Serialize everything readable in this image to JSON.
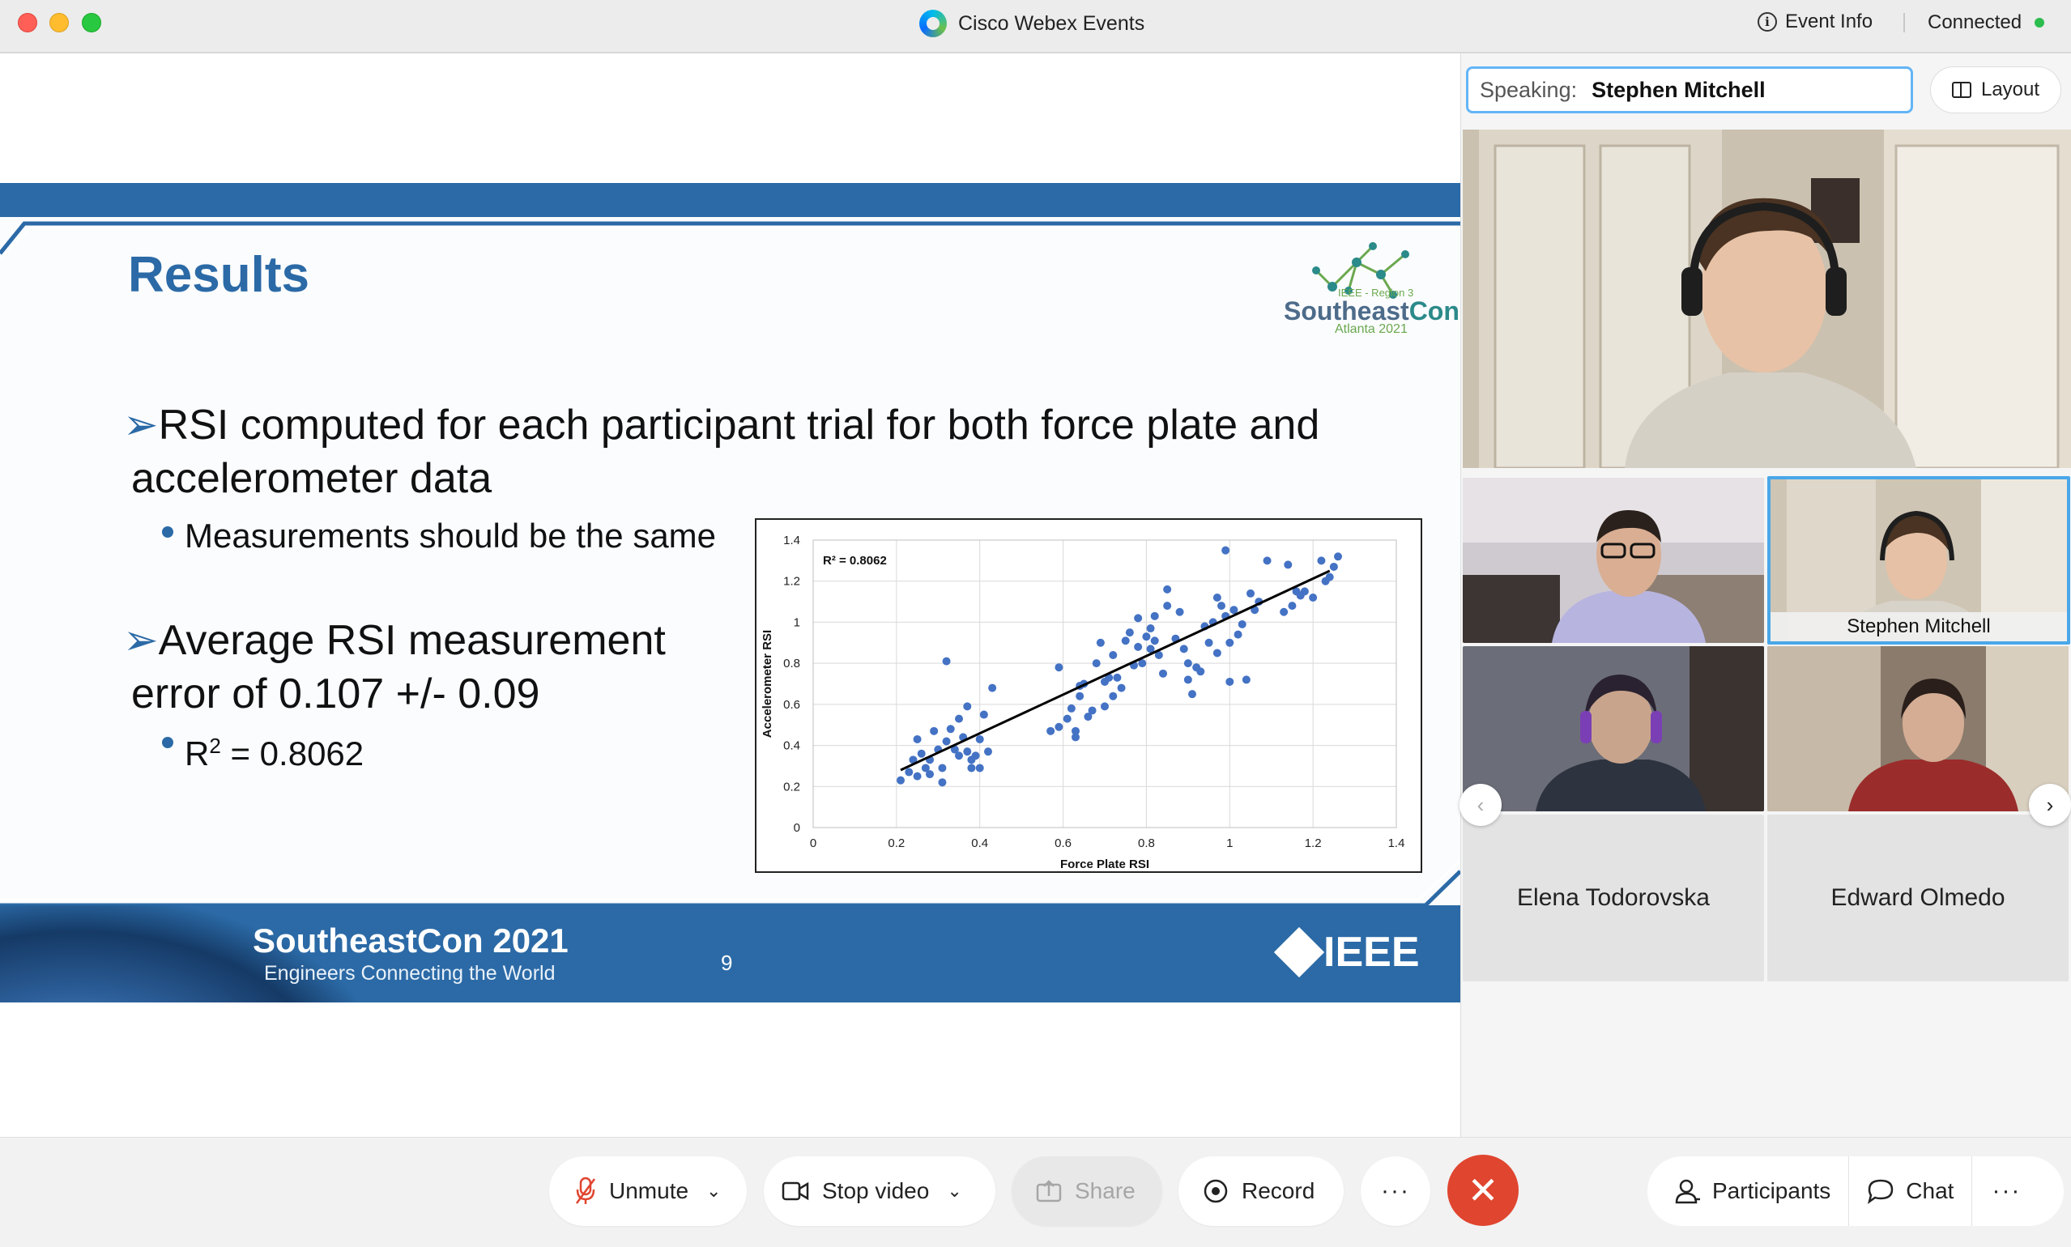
{
  "window": {
    "title": "Cisco Webex Events",
    "event_info": "Event Info",
    "status": "Connected"
  },
  "slide": {
    "title": "Results",
    "logo": {
      "line1": "IEEE - Region 3",
      "word_a": "Southeast",
      "word_b": "Con",
      "sub": "Atlanta 2021"
    },
    "bullets": [
      {
        "text": "RSI computed for each participant trial for both force plate and accelerometer data",
        "sub": "Measurements should be the same"
      },
      {
        "text": "Average RSI measurement error of 0.107 +/- 0.09",
        "sub_prefix": "R",
        "sub_sup": "2",
        "sub_suffix": " = 0.8062"
      }
    ],
    "footer": {
      "title": "SoutheastCon 2021",
      "subtitle": "Engineers Connecting the World",
      "page": "9",
      "org": "IEEE"
    }
  },
  "chart_data": {
    "type": "scatter",
    "xlabel": "Force Plate RSI",
    "ylabel": "Accelerometer RSI",
    "annotation": "R² = 0.8062",
    "xlim": [
      0,
      1.4
    ],
    "ylim": [
      0,
      1.4
    ],
    "xticks": [
      "0",
      "0.2",
      "0.4",
      "0.6",
      "0.8",
      "1",
      "1.2",
      "1.4"
    ],
    "yticks": [
      "0",
      "0.2",
      "0.4",
      "0.6",
      "0.8",
      "1",
      "1.2",
      "1.4"
    ],
    "grid": true,
    "point_color": "#4472c4",
    "trendline": {
      "x1": 0.21,
      "y1": 0.28,
      "x2": 1.24,
      "y2": 1.25
    },
    "points": [
      [
        0.21,
        0.23
      ],
      [
        0.23,
        0.27
      ],
      [
        0.24,
        0.33
      ],
      [
        0.25,
        0.25
      ],
      [
        0.25,
        0.43
      ],
      [
        0.26,
        0.36
      ],
      [
        0.27,
        0.29
      ],
      [
        0.28,
        0.33
      ],
      [
        0.28,
        0.26
      ],
      [
        0.29,
        0.47
      ],
      [
        0.3,
        0.38
      ],
      [
        0.31,
        0.22
      ],
      [
        0.31,
        0.29
      ],
      [
        0.32,
        0.42
      ],
      [
        0.32,
        0.81
      ],
      [
        0.33,
        0.48
      ],
      [
        0.34,
        0.38
      ],
      [
        0.35,
        0.35
      ],
      [
        0.35,
        0.53
      ],
      [
        0.36,
        0.44
      ],
      [
        0.37,
        0.37
      ],
      [
        0.37,
        0.59
      ],
      [
        0.38,
        0.33
      ],
      [
        0.38,
        0.29
      ],
      [
        0.39,
        0.35
      ],
      [
        0.4,
        0.29
      ],
      [
        0.4,
        0.43
      ],
      [
        0.41,
        0.55
      ],
      [
        0.42,
        0.37
      ],
      [
        0.43,
        0.68
      ],
      [
        0.57,
        0.47
      ],
      [
        0.59,
        0.49
      ],
      [
        0.59,
        0.78
      ],
      [
        0.61,
        0.53
      ],
      [
        0.62,
        0.58
      ],
      [
        0.63,
        0.44
      ],
      [
        0.63,
        0.47
      ],
      [
        0.64,
        0.64
      ],
      [
        0.64,
        0.69
      ],
      [
        0.65,
        0.7
      ],
      [
        0.66,
        0.54
      ],
      [
        0.67,
        0.57
      ],
      [
        0.68,
        0.8
      ],
      [
        0.69,
        0.9
      ],
      [
        0.7,
        0.71
      ],
      [
        0.7,
        0.59
      ],
      [
        0.71,
        0.73
      ],
      [
        0.72,
        0.84
      ],
      [
        0.72,
        0.64
      ],
      [
        0.73,
        0.73
      ],
      [
        0.74,
        0.68
      ],
      [
        0.75,
        0.91
      ],
      [
        0.76,
        0.95
      ],
      [
        0.77,
        0.79
      ],
      [
        0.78,
        0.88
      ],
      [
        0.78,
        1.02
      ],
      [
        0.79,
        0.8
      ],
      [
        0.8,
        0.93
      ],
      [
        0.81,
        0.87
      ],
      [
        0.81,
        0.97
      ],
      [
        0.82,
        1.03
      ],
      [
        0.82,
        0.91
      ],
      [
        0.83,
        0.84
      ],
      [
        0.84,
        0.75
      ],
      [
        0.85,
        1.08
      ],
      [
        0.85,
        1.16
      ],
      [
        0.87,
        0.92
      ],
      [
        0.88,
        1.05
      ],
      [
        0.89,
        0.87
      ],
      [
        0.9,
        0.72
      ],
      [
        0.9,
        0.8
      ],
      [
        0.91,
        0.65
      ],
      [
        0.92,
        0.78
      ],
      [
        0.93,
        0.76
      ],
      [
        0.94,
        0.98
      ],
      [
        0.95,
        0.9
      ],
      [
        0.96,
        1.0
      ],
      [
        0.97,
        0.85
      ],
      [
        0.97,
        1.12
      ],
      [
        0.98,
        1.08
      ],
      [
        0.99,
        1.03
      ],
      [
        0.99,
        1.35
      ],
      [
        1.0,
        0.9
      ],
      [
        1.0,
        0.71
      ],
      [
        1.01,
        1.06
      ],
      [
        1.02,
        0.94
      ],
      [
        1.03,
        0.99
      ],
      [
        1.04,
        0.72
      ],
      [
        1.05,
        1.14
      ],
      [
        1.06,
        1.06
      ],
      [
        1.07,
        1.1
      ],
      [
        1.09,
        1.3
      ],
      [
        1.13,
        1.05
      ],
      [
        1.14,
        1.28
      ],
      [
        1.15,
        1.08
      ],
      [
        1.16,
        1.15
      ],
      [
        1.17,
        1.13
      ],
      [
        1.18,
        1.15
      ],
      [
        1.2,
        1.12
      ],
      [
        1.22,
        1.3
      ],
      [
        1.23,
        1.2
      ],
      [
        1.24,
        1.22
      ],
      [
        1.25,
        1.27
      ],
      [
        1.26,
        1.32
      ]
    ]
  },
  "sidebar": {
    "speaking_label": "Speaking:",
    "speaker": "Stephen Mitchell",
    "layout": "Layout",
    "tiles": [
      {
        "name": ""
      },
      {
        "name": "Stephen Mitchell"
      },
      {
        "name": ""
      },
      {
        "name": ""
      },
      {
        "name": "Elena Todorovska"
      },
      {
        "name": "Edward Olmedo"
      }
    ]
  },
  "controls": {
    "unmute": "Unmute",
    "stop_video": "Stop video",
    "share": "Share",
    "record": "Record",
    "more": "···",
    "participants": "Participants",
    "chat": "Chat"
  }
}
